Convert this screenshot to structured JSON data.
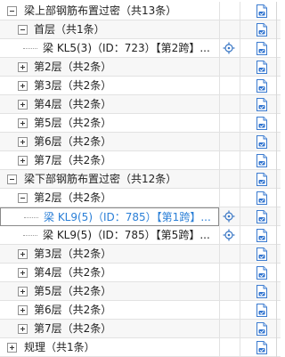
{
  "tree": {
    "rows": [
      {
        "type": "group",
        "expanded": true,
        "label": "梁上部钢筋布置过密（共13条）"
      },
      {
        "type": "floor",
        "expanded": true,
        "label": "首层（共1条）"
      },
      {
        "type": "item",
        "label": "梁 KL5(3)（ID：723）【第2跨】..."
      },
      {
        "type": "floor",
        "expanded": false,
        "label": "第2层（共2条）"
      },
      {
        "type": "floor",
        "expanded": false,
        "label": "第3层（共2条）"
      },
      {
        "type": "floor",
        "expanded": false,
        "label": "第4层（共2条）"
      },
      {
        "type": "floor",
        "expanded": false,
        "label": "第5层（共2条）"
      },
      {
        "type": "floor",
        "expanded": false,
        "label": "第6层（共2条）"
      },
      {
        "type": "floor",
        "expanded": false,
        "label": "第7层（共2条）"
      },
      {
        "type": "group",
        "expanded": true,
        "label": "梁下部钢筋布置过密（共12条）"
      },
      {
        "type": "floor",
        "expanded": true,
        "label": "第2层（共2条）"
      },
      {
        "type": "item",
        "selected": true,
        "label": "梁 KL9(5)（ID：785）【第1跨】..."
      },
      {
        "type": "item",
        "label": "梁 KL9(5)（ID：785）【第5跨】..."
      },
      {
        "type": "floor",
        "expanded": false,
        "label": "第3层（共2条）"
      },
      {
        "type": "floor",
        "expanded": false,
        "label": "第4层（共2条）"
      },
      {
        "type": "floor",
        "expanded": false,
        "label": "第5层（共2条）"
      },
      {
        "type": "floor",
        "expanded": false,
        "label": "第6层（共2条）"
      },
      {
        "type": "floor",
        "expanded": false,
        "label": "第7层（共2条）"
      },
      {
        "type": "group",
        "expanded": false,
        "label": "规理（共1条）"
      }
    ]
  },
  "icons": {
    "locate": "crosshair-locate-icon",
    "doc": "document-edit-icon"
  },
  "colors": {
    "link": "#2b7fd7",
    "row_alt": "#f7f7f7",
    "grid": "#e2e2e2",
    "selected_border": "#8a8a8a"
  }
}
